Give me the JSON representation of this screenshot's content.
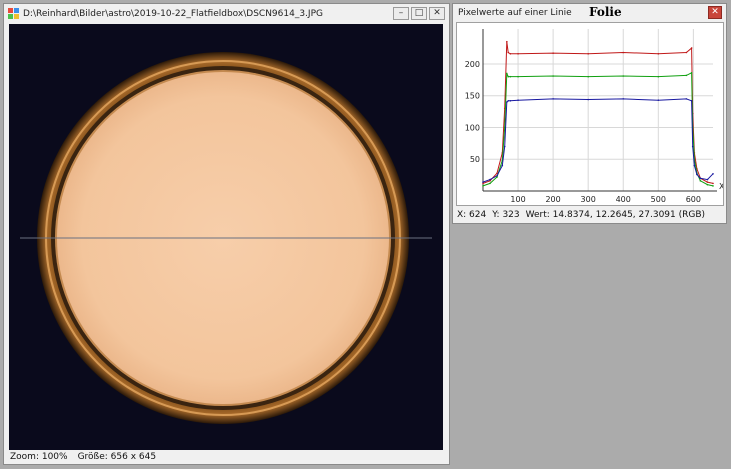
{
  "image_window": {
    "title": "D:\\Reinhard\\Bilder\\astro\\2019-10-22_Flatfieldbox\\DSCN9614_3.JPG",
    "status": {
      "zoom": "Zoom: 100%",
      "size": "Größe: 656 x 645"
    },
    "icon": "image-app-icon",
    "controls": [
      "minimize-icon",
      "restore-icon",
      "close-icon"
    ]
  },
  "profile_window": {
    "title": "Pixelwerte auf einer Linie",
    "heading": "Folie",
    "controls": [
      "close-icon"
    ],
    "status": {
      "x": "X: 624",
      "y": "Y: 323",
      "value": "Wert: 14.8374, 12.2645, 27.3091 (RGB)"
    }
  },
  "colors": {
    "flat_field": "#f4c7a0",
    "background": "#0a0a1c",
    "ring": "#8a5a22",
    "red_series": "#c01818",
    "green_series": "#10a010",
    "blue_series": "#1818a0"
  },
  "chart_data": {
    "type": "line",
    "title": "",
    "xlabel": "X",
    "ylabel": "",
    "xlim": [
      0,
      656
    ],
    "ylim": [
      0,
      255
    ],
    "xticks": [
      100,
      200,
      300,
      400,
      500,
      600
    ],
    "yticks": [
      50,
      100,
      150,
      200
    ],
    "grid": true,
    "series": [
      {
        "color": "#c01818",
        "x": [
          0,
          20,
          40,
          55,
          62,
          68,
          72,
          78,
          100,
          200,
          300,
          400,
          500,
          580,
          595,
          598,
          603,
          610,
          620,
          640,
          656
        ],
        "y": [
          12,
          16,
          28,
          60,
          130,
          235,
          218,
          216,
          216,
          217,
          216,
          218,
          216,
          218,
          225,
          122,
          60,
          35,
          20,
          14,
          12
        ]
      },
      {
        "color": "#10a010",
        "x": [
          0,
          20,
          40,
          55,
          62,
          68,
          72,
          78,
          100,
          200,
          300,
          400,
          500,
          580,
          595,
          598,
          603,
          610,
          620,
          640,
          656
        ],
        "y": [
          8,
          12,
          22,
          48,
          100,
          185,
          180,
          180,
          180,
          181,
          180,
          181,
          180,
          182,
          186,
          100,
          50,
          28,
          16,
          10,
          8
        ]
      },
      {
        "color": "#1818a0",
        "x": [
          0,
          20,
          40,
          55,
          62,
          68,
          72,
          78,
          100,
          200,
          300,
          400,
          500,
          580,
          595,
          598,
          603,
          610,
          620,
          640,
          656
        ],
        "y": [
          14,
          18,
          24,
          40,
          70,
          140,
          142,
          142,
          143,
          145,
          144,
          145,
          143,
          145,
          142,
          70,
          40,
          26,
          20,
          18,
          27
        ]
      }
    ]
  }
}
